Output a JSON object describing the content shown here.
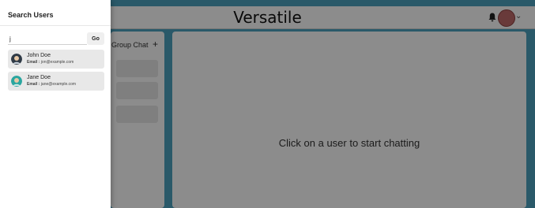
{
  "header": {
    "brand": "Versatile",
    "icons": [
      "bell-icon",
      "profile-avatar",
      "chevron-down-icon"
    ]
  },
  "sidebar": {
    "new_group_label": "Group Chat",
    "new_group_icon": "+"
  },
  "chat": {
    "placeholder_text": "Click on a user to start chatting"
  },
  "drawer": {
    "title": "Search Users",
    "search": {
      "value": "j",
      "go_label": "Go"
    },
    "results": [
      {
        "name": "John Doe",
        "email_label": "Email :",
        "email": "jon@example.com"
      },
      {
        "name": "Jane Doe",
        "email_label": "Email :",
        "email": "jane@example.com"
      }
    ]
  },
  "colors": {
    "accent": "#4ea3c0",
    "overlay": "#00000073"
  }
}
